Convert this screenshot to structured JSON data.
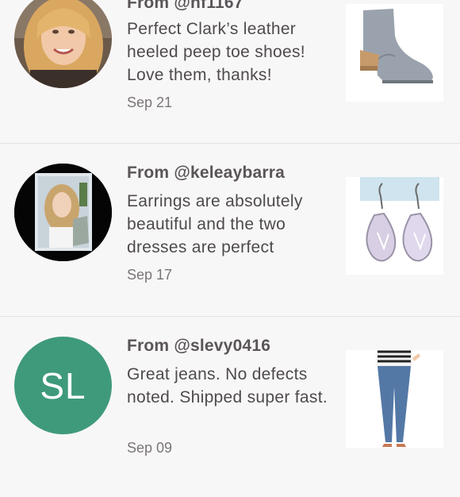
{
  "reviews": [
    {
      "from": "From @hf1167",
      "comment": "Perfect Clark’s leather heeled peep toe shoes! Love them, thanks!",
      "date": "Sep 21",
      "avatar_icon": "user-photo-blonde-woman",
      "product_icon": "gray-peep-toe-bootie"
    },
    {
      "from": "From @keleaybarra",
      "comment": "Earrings are absolutely beautiful and the two dresses are perfect",
      "date": "Sep 17",
      "avatar_icon": "user-photo-woman-selfie",
      "product_icon": "crystal-teardrop-earrings"
    },
    {
      "from": "From @slevy0416",
      "comment": "Great jeans. No defects noted. Shipped super fast.",
      "date": "Sep 09",
      "avatar_initials": "SL",
      "avatar_color": "#3f9a7c",
      "product_icon": "blue-skinny-jeans"
    }
  ],
  "colors": {
    "background": "#f8f7f8",
    "text": "#4e4a4d",
    "divider": "#e4e1e3"
  }
}
